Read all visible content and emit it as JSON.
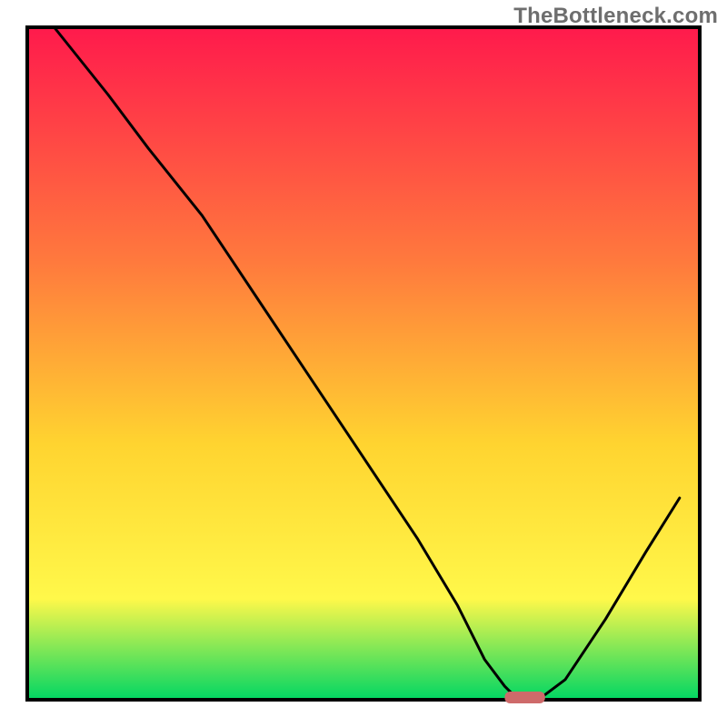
{
  "watermark": "TheBottleneck.com",
  "chart_data": {
    "type": "line",
    "title": "",
    "xlabel": "",
    "ylabel": "",
    "xlim": [
      0,
      100
    ],
    "ylim": [
      0,
      100
    ],
    "grid": false,
    "background_gradient": {
      "top_color": "#ff1a4c",
      "upper_mid_color": "#ff7a3d",
      "mid_color": "#ffd430",
      "lower_mid_color": "#fff84a",
      "bottom_color": "#00d663"
    },
    "curve": {
      "name": "bottleneck-curve",
      "color": "#000000",
      "x": [
        4,
        12,
        18,
        26,
        34,
        42,
        50,
        58,
        64,
        68,
        71,
        73,
        76,
        80,
        86,
        92,
        97
      ],
      "values": [
        100,
        90,
        82,
        72,
        60,
        48,
        36,
        24,
        14,
        6,
        2,
        0,
        0,
        3,
        12,
        22,
        30
      ]
    },
    "marker": {
      "name": "optimal-marker",
      "color": "#ce6a6a",
      "shape": "rounded-bar",
      "x_center": 74,
      "y": 0,
      "width_x_units": 6
    }
  }
}
